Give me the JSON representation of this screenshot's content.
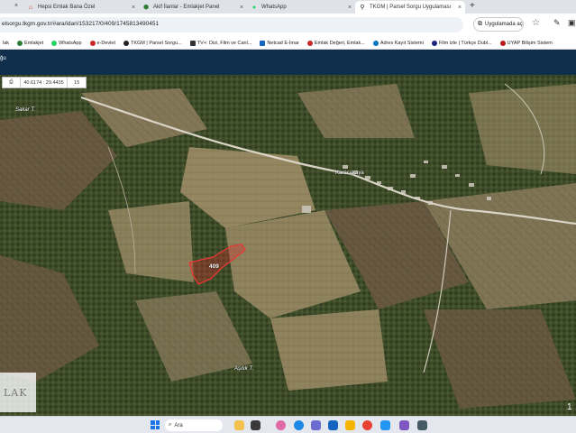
{
  "browser": {
    "tabs": [
      {
        "label": "Hepsi Emlak Bana Özel",
        "icon": "brand-icon",
        "color": "#d93025",
        "active": false
      },
      {
        "label": "Akif İlanlar - Emlakjet Panel",
        "icon": "emlakjet-icon",
        "color": "#2e7d32",
        "active": false
      },
      {
        "label": "WhatsApp",
        "icon": "whatsapp-icon",
        "color": "#25d366",
        "active": false
      },
      {
        "label": "TKGM | Parsel Sorgu Uygulaması",
        "icon": "location-pin-icon",
        "color": "#222",
        "active": true
      }
    ],
    "close_glyph": "×",
    "new_tab_glyph": "+",
    "url": "elsorgu.tkgm.gov.tr/#ara/idari/153217/0/409/1745813490451",
    "app_button_label": "Uygulamada aç",
    "bookmarks": [
      {
        "label": "lak",
        "color": "#d93025"
      },
      {
        "label": "Emlakjet",
        "color": "#2e7d32"
      },
      {
        "label": "WhatsApp",
        "color": "#25d366"
      },
      {
        "label": "e-Devlet",
        "color": "#c62828"
      },
      {
        "label": "TKGM | Parsel Sorgu...",
        "color": "#222"
      },
      {
        "label": "TV+: Dizi, Film ve Canl...",
        "color": "#333"
      },
      {
        "label": "Netcad E-İmar",
        "color": "#1565c0"
      },
      {
        "label": "Emlak Değeri, Emlak...",
        "color": "#c62828"
      },
      {
        "label": "Adres Kayıt Sistemi",
        "color": "#0277bd"
      },
      {
        "label": "Film izle | Türkçe Dubl...",
        "color": "#1a237e"
      },
      {
        "label": "UYAP Bilişim Sistem",
        "color": "#b71c1c"
      }
    ]
  },
  "site": {
    "title_fragment": "ğu",
    "header_color": "#0f2f4d"
  },
  "map": {
    "toolbar": {
      "print_icon": "printer-icon",
      "coordinates": "40.6174 : 29.4435",
      "zoom": "15"
    },
    "place_labels": [
      "Sakar T.",
      "Aşılık T."
    ],
    "village_label": "Karacakaya",
    "parcel_number": "409",
    "parcel_color": "#d32f2f",
    "logo_text": "LAK",
    "corner_digit": "1"
  },
  "taskbar": {
    "search_label": "Ara"
  }
}
